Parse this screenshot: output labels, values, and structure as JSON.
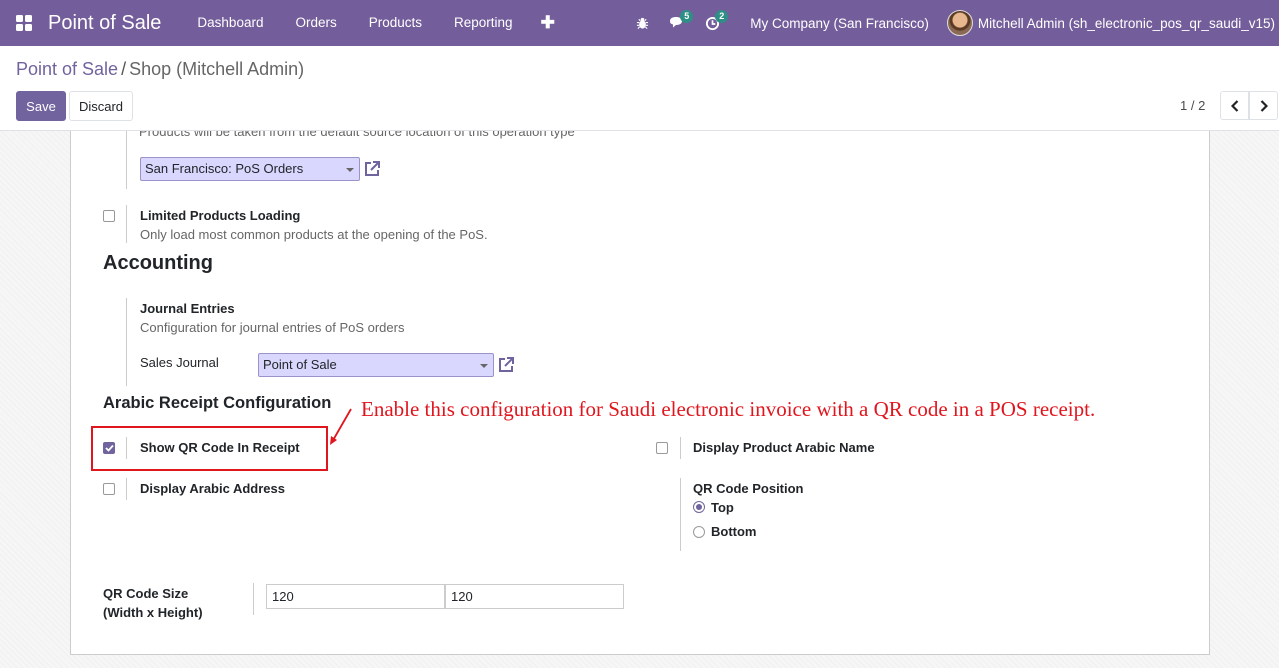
{
  "navbar": {
    "apps_icon": "grid-icon",
    "brand": "Point of Sale",
    "menu": [
      "Dashboard",
      "Orders",
      "Products",
      "Reporting"
    ],
    "new_icon": "plus-icon",
    "debug_icon": "bug-icon",
    "messages_icon": "chat-icon",
    "messages_count": "5",
    "activities_icon": "clock-icon",
    "activities_count": "2",
    "company": "My Company (San Francisco)",
    "user": "Mitchell Admin (sh_electronic_pos_qr_saudi_v15)"
  },
  "breadcrumb": {
    "parent": "Point of Sale",
    "separator": "/",
    "current": "Shop (Mitchell Admin)"
  },
  "actions": {
    "save": "Save",
    "discard": "Discard"
  },
  "pager": {
    "value": "1 / 2",
    "prev_icon": "chevron-left-icon",
    "next_icon": "chevron-right-icon"
  },
  "inventory": {
    "location_desc": "Products will be taken from the default source location of this operation type",
    "operation_type": "San Francisco: PoS Orders",
    "limited_loading": {
      "checked": false,
      "title": "Limited Products Loading",
      "desc": "Only load most common products at the opening of the PoS."
    }
  },
  "accounting": {
    "title": "Accounting",
    "journal_title": "Journal Entries",
    "journal_desc": "Configuration for journal entries of PoS orders",
    "sales_journal_label": "Sales Journal",
    "sales_journal_value": "Point of Sale"
  },
  "arabic": {
    "title": "Arabic Receipt Configuration",
    "show_qr": {
      "checked": true,
      "label": "Show QR Code In Receipt"
    },
    "arabic_name": {
      "checked": false,
      "label": "Display Product Arabic Name"
    },
    "arabic_address": {
      "checked": false,
      "label": "Display Arabic Address"
    },
    "qr_position": {
      "label": "QR Code Position",
      "options": [
        "Top",
        "Bottom"
      ],
      "selected": "Top"
    },
    "qr_size": {
      "label_line1": "QR Code Size",
      "label_line2": "(Width x Height)",
      "width": "120",
      "height": "120"
    }
  },
  "annotation": {
    "text": "Enable this configuration for Saudi electronic invoice with a QR code in a POS receipt.",
    "color": "#e0161e"
  },
  "colors": {
    "navbar": "#735d9a",
    "primary": "#71639e",
    "select_bg": "#d9d7fe"
  }
}
